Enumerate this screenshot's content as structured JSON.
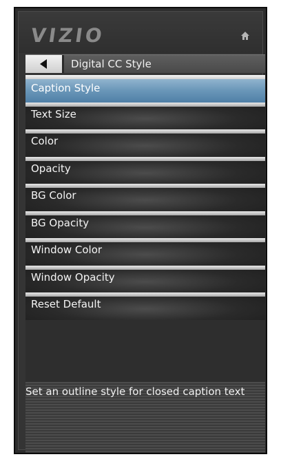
{
  "header": {
    "logo": "VIZIO",
    "home_icon": "home-icon"
  },
  "title_bar": {
    "back_icon": "back-arrow-icon",
    "title": "Digital CC Style"
  },
  "menu": {
    "items": [
      {
        "label": "Caption Style",
        "selected": true
      },
      {
        "label": "Text Size",
        "selected": false
      },
      {
        "label": "Color",
        "selected": false
      },
      {
        "label": "Opacity",
        "selected": false
      },
      {
        "label": "BG Color",
        "selected": false
      },
      {
        "label": "BG Opacity",
        "selected": false
      },
      {
        "label": "Window Color",
        "selected": false
      },
      {
        "label": "Window Opacity",
        "selected": false
      },
      {
        "label": "Reset Default",
        "selected": false
      }
    ]
  },
  "help": {
    "text": "Set an outline style for closed caption text"
  },
  "colors": {
    "selection": "#6b97b9",
    "panel_bg": "#2d2d2d",
    "text": "#f4f4f4"
  }
}
